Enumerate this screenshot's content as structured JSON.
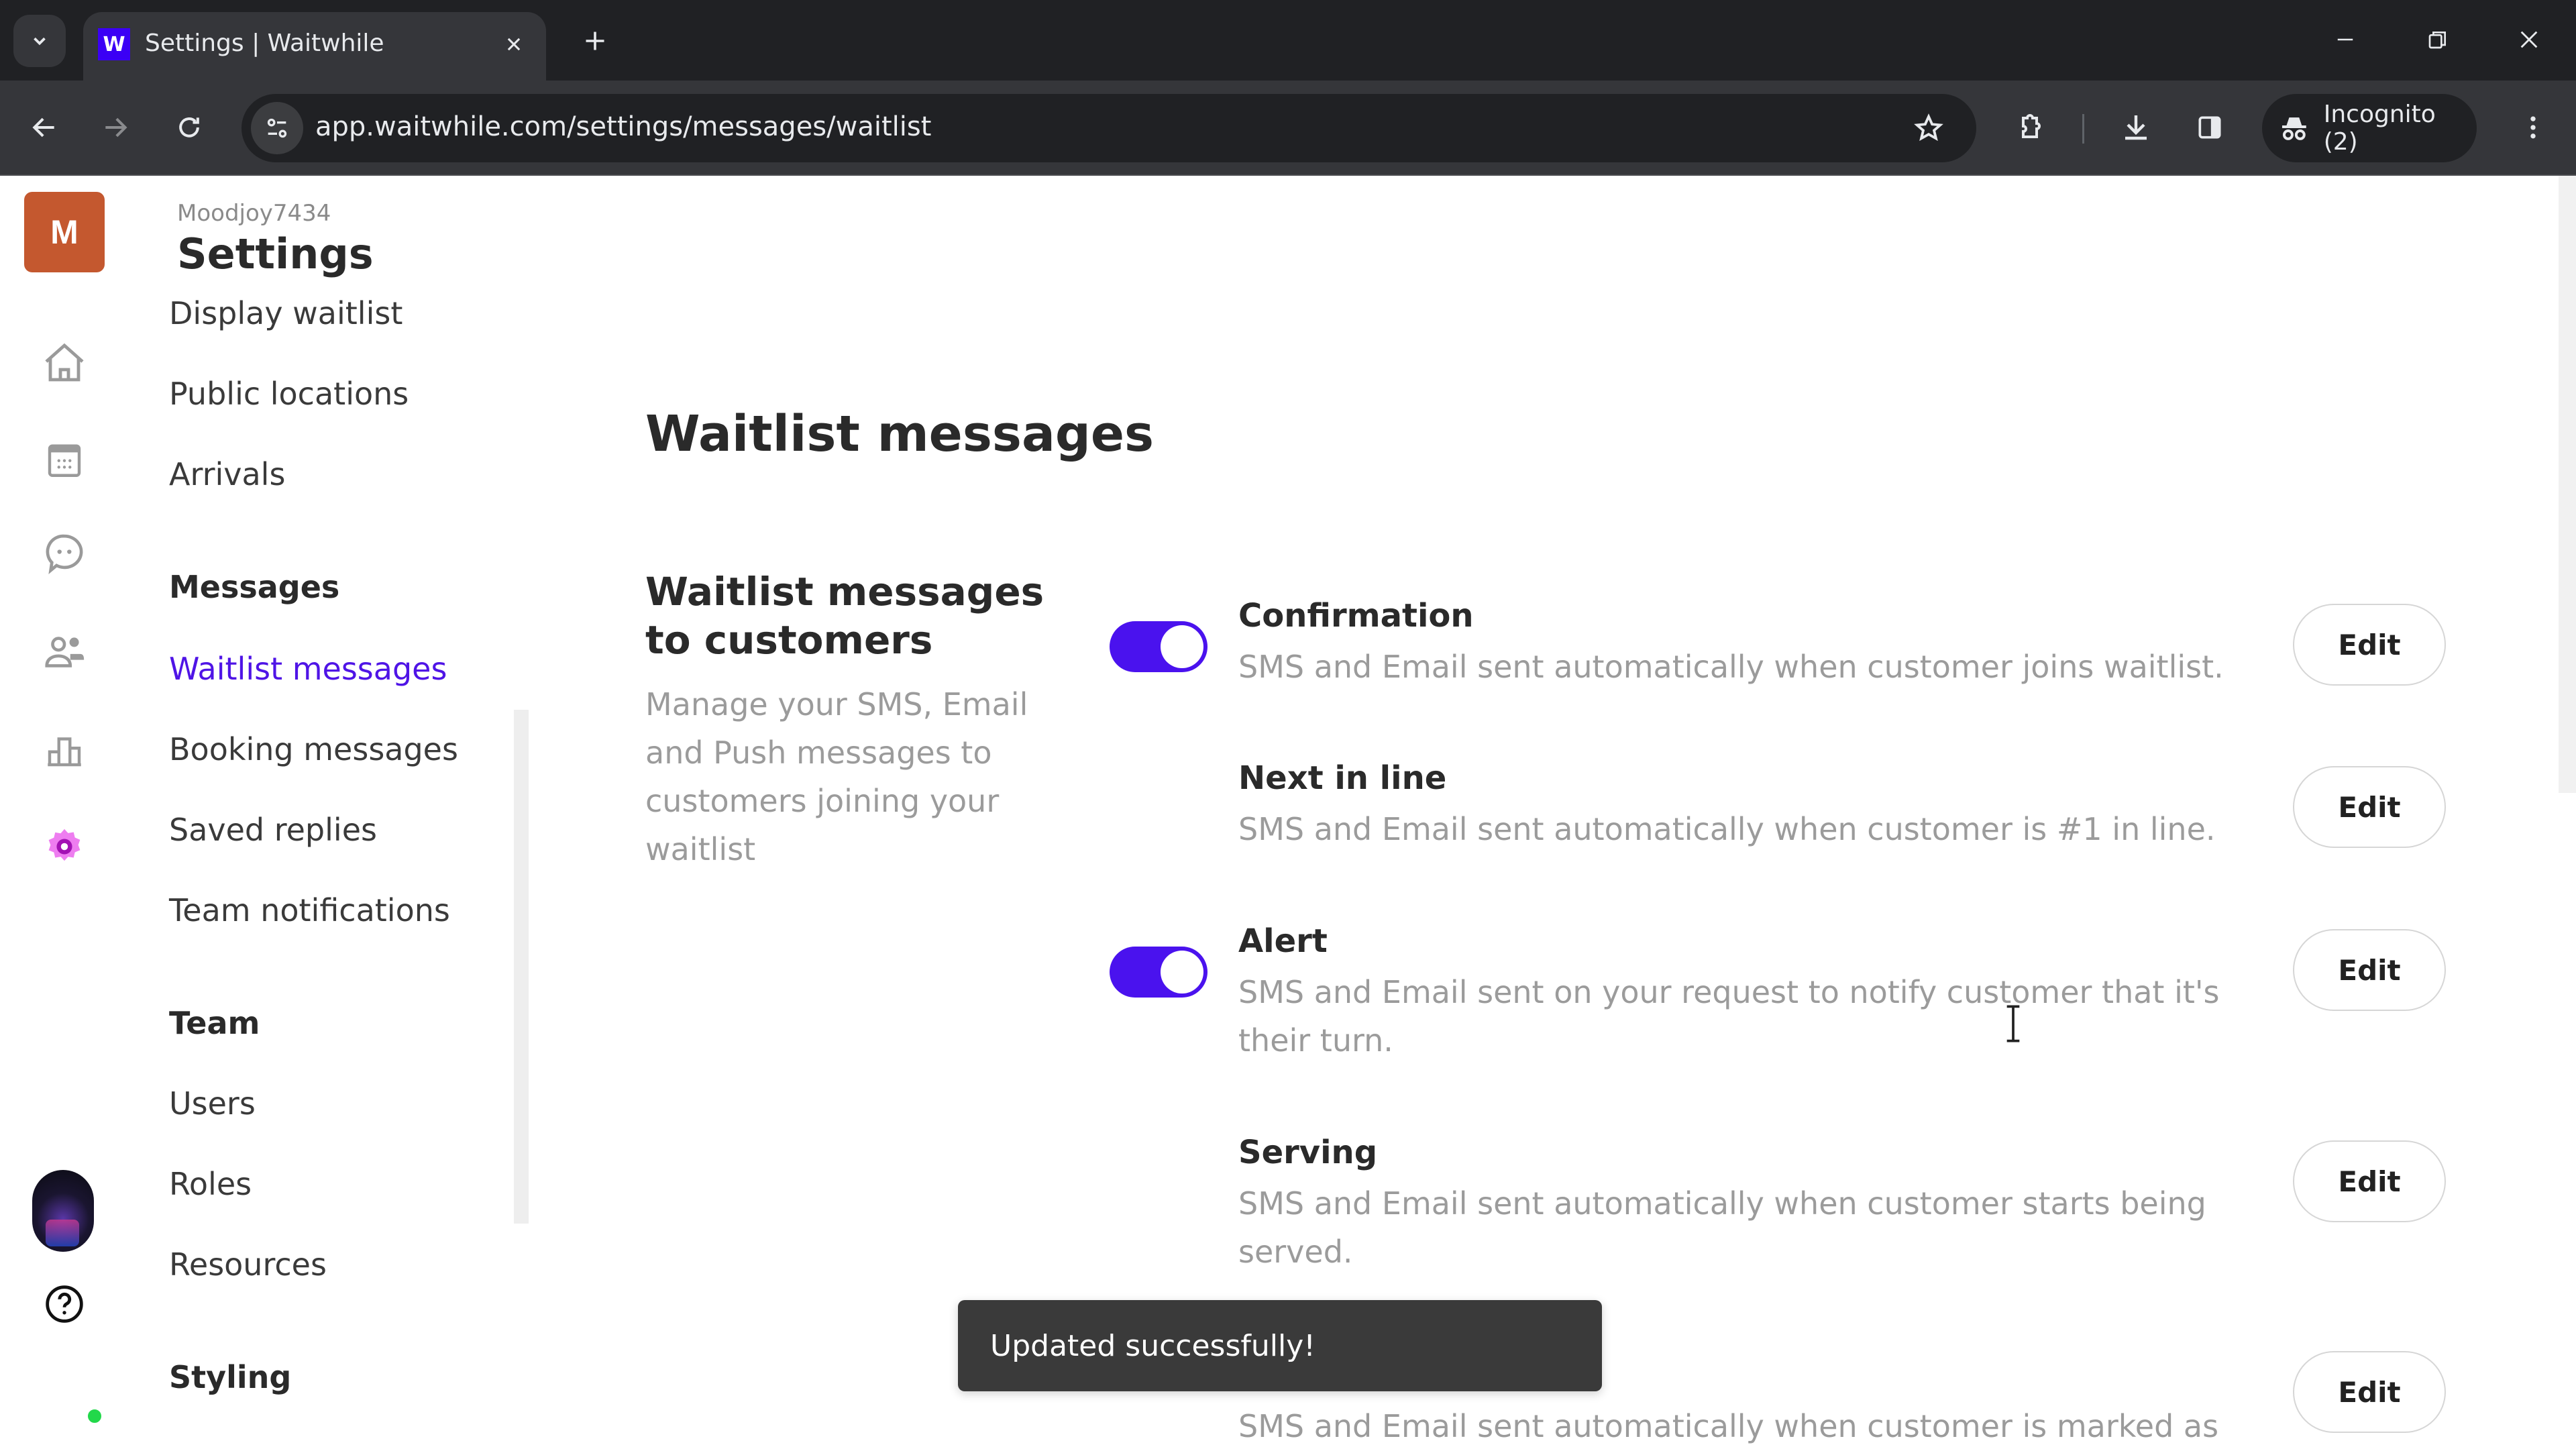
{
  "browser": {
    "tab_title": "Settings | Waitwhile",
    "favicon_letter": "W",
    "url": "app.waitwhile.com/settings/messages/waitlist",
    "incognito_label": "Incognito (2)",
    "accent_color": "#3b00f5"
  },
  "rail": {
    "org_initial": "M",
    "org_color": "#c4582f",
    "icons": [
      "home-icon",
      "calendar-icon",
      "chat-icon",
      "customers-icon",
      "analytics-icon",
      "settings-icon",
      "help-icon"
    ]
  },
  "settings_nav": {
    "account_name": "Moodjoy7434",
    "title": "Settings",
    "items_top": [
      {
        "label": "Display waitlist"
      },
      {
        "label": "Public locations"
      },
      {
        "label": "Arrivals"
      }
    ],
    "groups": [
      {
        "label": "Messages",
        "items": [
          {
            "label": "Waitlist messages",
            "active": true
          },
          {
            "label": "Booking messages",
            "active": false
          },
          {
            "label": "Saved replies",
            "active": false
          },
          {
            "label": "Team notifications",
            "active": false
          }
        ]
      },
      {
        "label": "Team",
        "items": [
          {
            "label": "Users",
            "active": false
          },
          {
            "label": "Roles",
            "active": false
          },
          {
            "label": "Resources",
            "active": false
          }
        ]
      },
      {
        "label": "Styling",
        "items": []
      }
    ]
  },
  "main": {
    "page_title": "Waitlist messages",
    "section_title": "Waitlist messages to customers",
    "section_description": "Manage your SMS, Email and Push messages to customers joining your waitlist",
    "edit_label": "Edit",
    "messages": [
      {
        "title": "Confirmation",
        "description": "SMS and Email sent automatically when customer joins waitlist.",
        "toggle_visible": true,
        "enabled": true
      },
      {
        "title": "Next in line",
        "description": "SMS and Email sent automatically when customer is #1 in line.",
        "toggle_visible": false,
        "enabled": false
      },
      {
        "title": "Alert",
        "description": "SMS and Email sent on your request to notify customer that it's their turn.",
        "toggle_visible": true,
        "enabled": true
      },
      {
        "title": "Serving",
        "description": "SMS and Email sent automatically when customer starts being served.",
        "toggle_visible": false,
        "enabled": false
      },
      {
        "title": "",
        "description": "SMS and Email sent automatically when customer is marked as",
        "toggle_visible": false,
        "enabled": false
      }
    ]
  },
  "toast": {
    "message": "Updated successfully!"
  }
}
